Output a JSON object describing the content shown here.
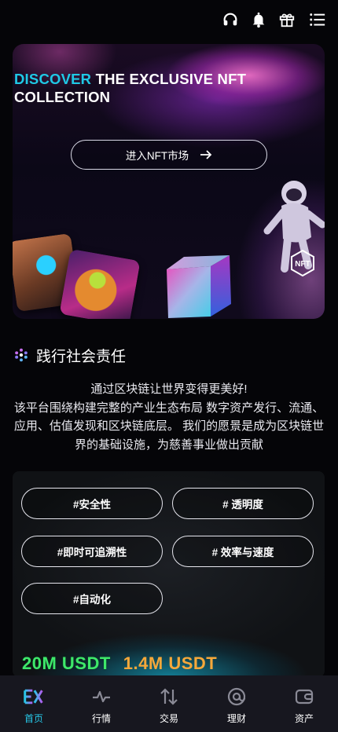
{
  "header": {
    "icons": [
      "headset-icon",
      "bell-icon",
      "gift-icon",
      "menu-icon"
    ]
  },
  "hero": {
    "title_accent": "DISCOVER",
    "title_rest": " THE EXCLUSIVE NFT COLLECTION",
    "button_label": "进入NFT市场",
    "badge_text": "NFT"
  },
  "section": {
    "title": "践行社会责任",
    "lines": [
      "通过区块链让世界变得更美好!",
      "该平台围绕构建完整的产业生态布局 数字资产发行、流通、应用、估值发现和区块链底层。 我们的愿景是成为区块链世界的基础设施，为慈善事业做出贡献"
    ]
  },
  "features": {
    "tags": [
      "#安全性",
      "# 透明度",
      "#即时可追溯性",
      "# 效率与速度",
      "#自动化"
    ],
    "stats": [
      "20M USDT",
      "1.4M USDT"
    ]
  },
  "nav": {
    "items": [
      {
        "label": "首页",
        "icon": "home-logo-icon"
      },
      {
        "label": "行情",
        "icon": "pulse-icon"
      },
      {
        "label": "交易",
        "icon": "swap-icon"
      },
      {
        "label": "理财",
        "icon": "finance-icon"
      },
      {
        "label": "资产",
        "icon": "wallet-icon"
      }
    ],
    "active_index": 0
  },
  "colors": {
    "accent": "#27c8e8",
    "stat_green": "#3ee86a",
    "stat_orange": "#f6a83a",
    "background": "#050508"
  }
}
